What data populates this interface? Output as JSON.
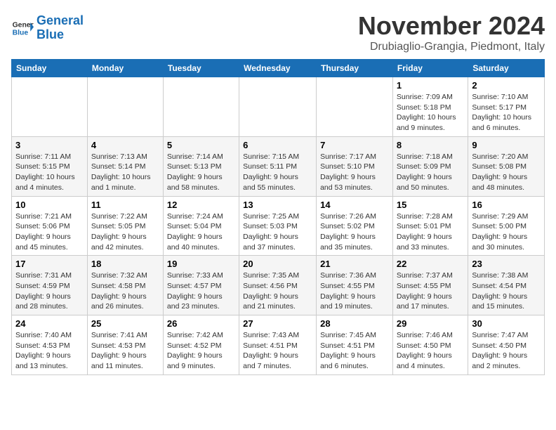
{
  "header": {
    "logo_line1": "General",
    "logo_line2": "Blue",
    "month": "November 2024",
    "location": "Drubiaglio-Grangia, Piedmont, Italy"
  },
  "weekdays": [
    "Sunday",
    "Monday",
    "Tuesday",
    "Wednesday",
    "Thursday",
    "Friday",
    "Saturday"
  ],
  "weeks": [
    [
      {
        "day": "",
        "info": ""
      },
      {
        "day": "",
        "info": ""
      },
      {
        "day": "",
        "info": ""
      },
      {
        "day": "",
        "info": ""
      },
      {
        "day": "",
        "info": ""
      },
      {
        "day": "1",
        "info": "Sunrise: 7:09 AM\nSunset: 5:18 PM\nDaylight: 10 hours and 9 minutes."
      },
      {
        "day": "2",
        "info": "Sunrise: 7:10 AM\nSunset: 5:17 PM\nDaylight: 10 hours and 6 minutes."
      }
    ],
    [
      {
        "day": "3",
        "info": "Sunrise: 7:11 AM\nSunset: 5:15 PM\nDaylight: 10 hours and 4 minutes."
      },
      {
        "day": "4",
        "info": "Sunrise: 7:13 AM\nSunset: 5:14 PM\nDaylight: 10 hours and 1 minute."
      },
      {
        "day": "5",
        "info": "Sunrise: 7:14 AM\nSunset: 5:13 PM\nDaylight: 9 hours and 58 minutes."
      },
      {
        "day": "6",
        "info": "Sunrise: 7:15 AM\nSunset: 5:11 PM\nDaylight: 9 hours and 55 minutes."
      },
      {
        "day": "7",
        "info": "Sunrise: 7:17 AM\nSunset: 5:10 PM\nDaylight: 9 hours and 53 minutes."
      },
      {
        "day": "8",
        "info": "Sunrise: 7:18 AM\nSunset: 5:09 PM\nDaylight: 9 hours and 50 minutes."
      },
      {
        "day": "9",
        "info": "Sunrise: 7:20 AM\nSunset: 5:08 PM\nDaylight: 9 hours and 48 minutes."
      }
    ],
    [
      {
        "day": "10",
        "info": "Sunrise: 7:21 AM\nSunset: 5:06 PM\nDaylight: 9 hours and 45 minutes."
      },
      {
        "day": "11",
        "info": "Sunrise: 7:22 AM\nSunset: 5:05 PM\nDaylight: 9 hours and 42 minutes."
      },
      {
        "day": "12",
        "info": "Sunrise: 7:24 AM\nSunset: 5:04 PM\nDaylight: 9 hours and 40 minutes."
      },
      {
        "day": "13",
        "info": "Sunrise: 7:25 AM\nSunset: 5:03 PM\nDaylight: 9 hours and 37 minutes."
      },
      {
        "day": "14",
        "info": "Sunrise: 7:26 AM\nSunset: 5:02 PM\nDaylight: 9 hours and 35 minutes."
      },
      {
        "day": "15",
        "info": "Sunrise: 7:28 AM\nSunset: 5:01 PM\nDaylight: 9 hours and 33 minutes."
      },
      {
        "day": "16",
        "info": "Sunrise: 7:29 AM\nSunset: 5:00 PM\nDaylight: 9 hours and 30 minutes."
      }
    ],
    [
      {
        "day": "17",
        "info": "Sunrise: 7:31 AM\nSunset: 4:59 PM\nDaylight: 9 hours and 28 minutes."
      },
      {
        "day": "18",
        "info": "Sunrise: 7:32 AM\nSunset: 4:58 PM\nDaylight: 9 hours and 26 minutes."
      },
      {
        "day": "19",
        "info": "Sunrise: 7:33 AM\nSunset: 4:57 PM\nDaylight: 9 hours and 23 minutes."
      },
      {
        "day": "20",
        "info": "Sunrise: 7:35 AM\nSunset: 4:56 PM\nDaylight: 9 hours and 21 minutes."
      },
      {
        "day": "21",
        "info": "Sunrise: 7:36 AM\nSunset: 4:55 PM\nDaylight: 9 hours and 19 minutes."
      },
      {
        "day": "22",
        "info": "Sunrise: 7:37 AM\nSunset: 4:55 PM\nDaylight: 9 hours and 17 minutes."
      },
      {
        "day": "23",
        "info": "Sunrise: 7:38 AM\nSunset: 4:54 PM\nDaylight: 9 hours and 15 minutes."
      }
    ],
    [
      {
        "day": "24",
        "info": "Sunrise: 7:40 AM\nSunset: 4:53 PM\nDaylight: 9 hours and 13 minutes."
      },
      {
        "day": "25",
        "info": "Sunrise: 7:41 AM\nSunset: 4:53 PM\nDaylight: 9 hours and 11 minutes."
      },
      {
        "day": "26",
        "info": "Sunrise: 7:42 AM\nSunset: 4:52 PM\nDaylight: 9 hours and 9 minutes."
      },
      {
        "day": "27",
        "info": "Sunrise: 7:43 AM\nSunset: 4:51 PM\nDaylight: 9 hours and 7 minutes."
      },
      {
        "day": "28",
        "info": "Sunrise: 7:45 AM\nSunset: 4:51 PM\nDaylight: 9 hours and 6 minutes."
      },
      {
        "day": "29",
        "info": "Sunrise: 7:46 AM\nSunset: 4:50 PM\nDaylight: 9 hours and 4 minutes."
      },
      {
        "day": "30",
        "info": "Sunrise: 7:47 AM\nSunset: 4:50 PM\nDaylight: 9 hours and 2 minutes."
      }
    ]
  ]
}
